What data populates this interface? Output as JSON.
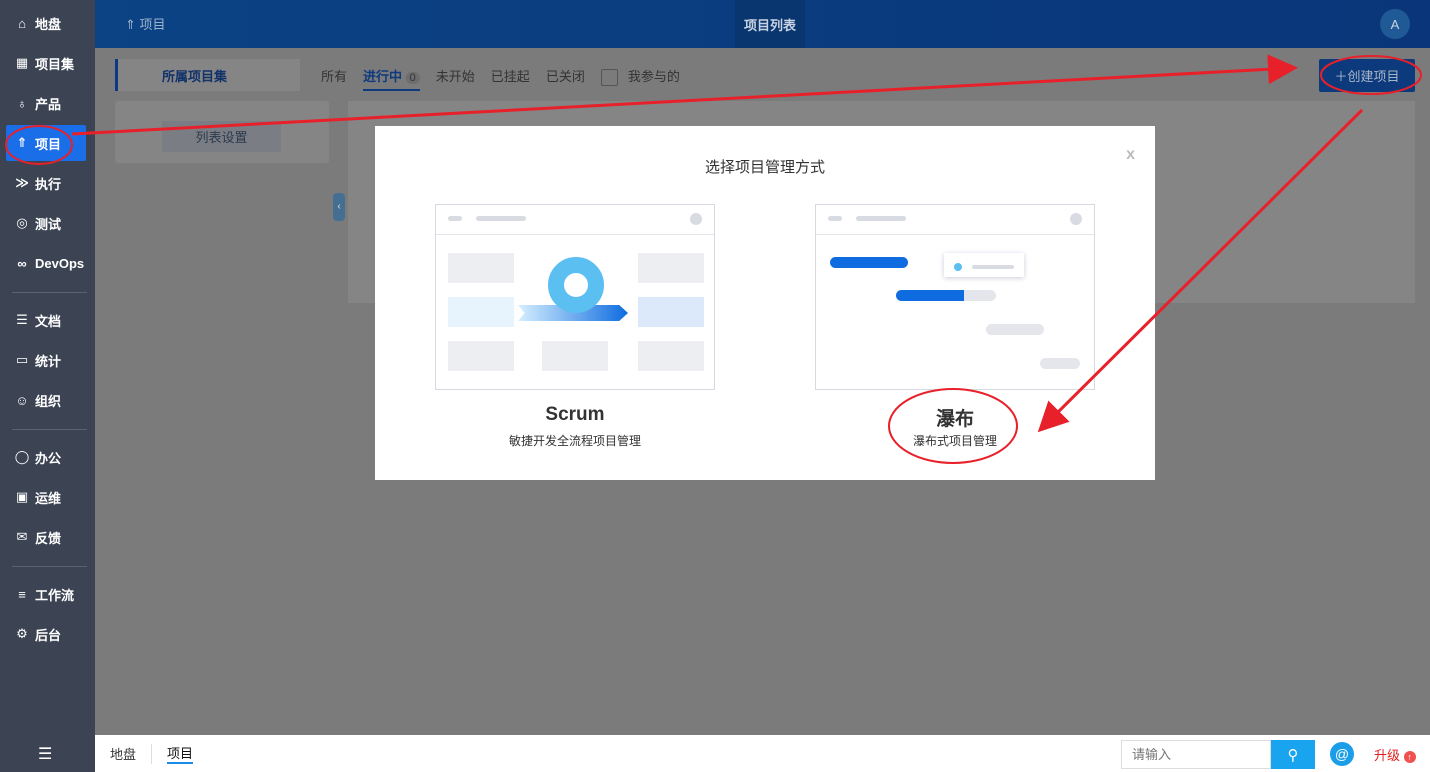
{
  "sidebar": {
    "items": [
      {
        "label": "地盘",
        "icon": "home-icon"
      },
      {
        "label": "项目集",
        "icon": "grid-icon"
      },
      {
        "label": "产品",
        "icon": "bulb-icon"
      },
      {
        "label": "项目",
        "icon": "rocket-icon"
      },
      {
        "label": "执行",
        "icon": "run-icon"
      },
      {
        "label": "测试",
        "icon": "test-icon"
      },
      {
        "label": "DevOps",
        "icon": "infinity-icon"
      },
      {
        "label": "文档",
        "icon": "doc-icon"
      },
      {
        "label": "统计",
        "icon": "chart-icon"
      },
      {
        "label": "组织",
        "icon": "users-icon"
      },
      {
        "label": "办公",
        "icon": "oa-icon"
      },
      {
        "label": "运维",
        "icon": "ops-icon"
      },
      {
        "label": "反馈",
        "icon": "feedback-icon"
      },
      {
        "label": "工作流",
        "icon": "workflow-icon"
      },
      {
        "label": "后台",
        "icon": "gear-icon"
      }
    ]
  },
  "header": {
    "module": "项目",
    "title": "项目列表",
    "avatar": "A"
  },
  "toolbar": {
    "program_label": "所属项目集",
    "tabs": [
      "所有",
      "进行中",
      "未开始",
      "已挂起",
      "已关闭"
    ],
    "active_count": "0",
    "mine_label": "我参与的",
    "create_label": "创建项目",
    "list_settings": "列表设置"
  },
  "modal": {
    "title": "选择项目管理方式",
    "close": "x",
    "options": [
      {
        "name": "Scrum",
        "desc": "敏捷开发全流程项目管理"
      },
      {
        "name": "瀑布",
        "desc": "瀑布式项目管理"
      }
    ]
  },
  "bottom": {
    "crumbs": [
      "地盘",
      "项目"
    ],
    "search_placeholder": "请输入",
    "upgrade": "升级"
  }
}
